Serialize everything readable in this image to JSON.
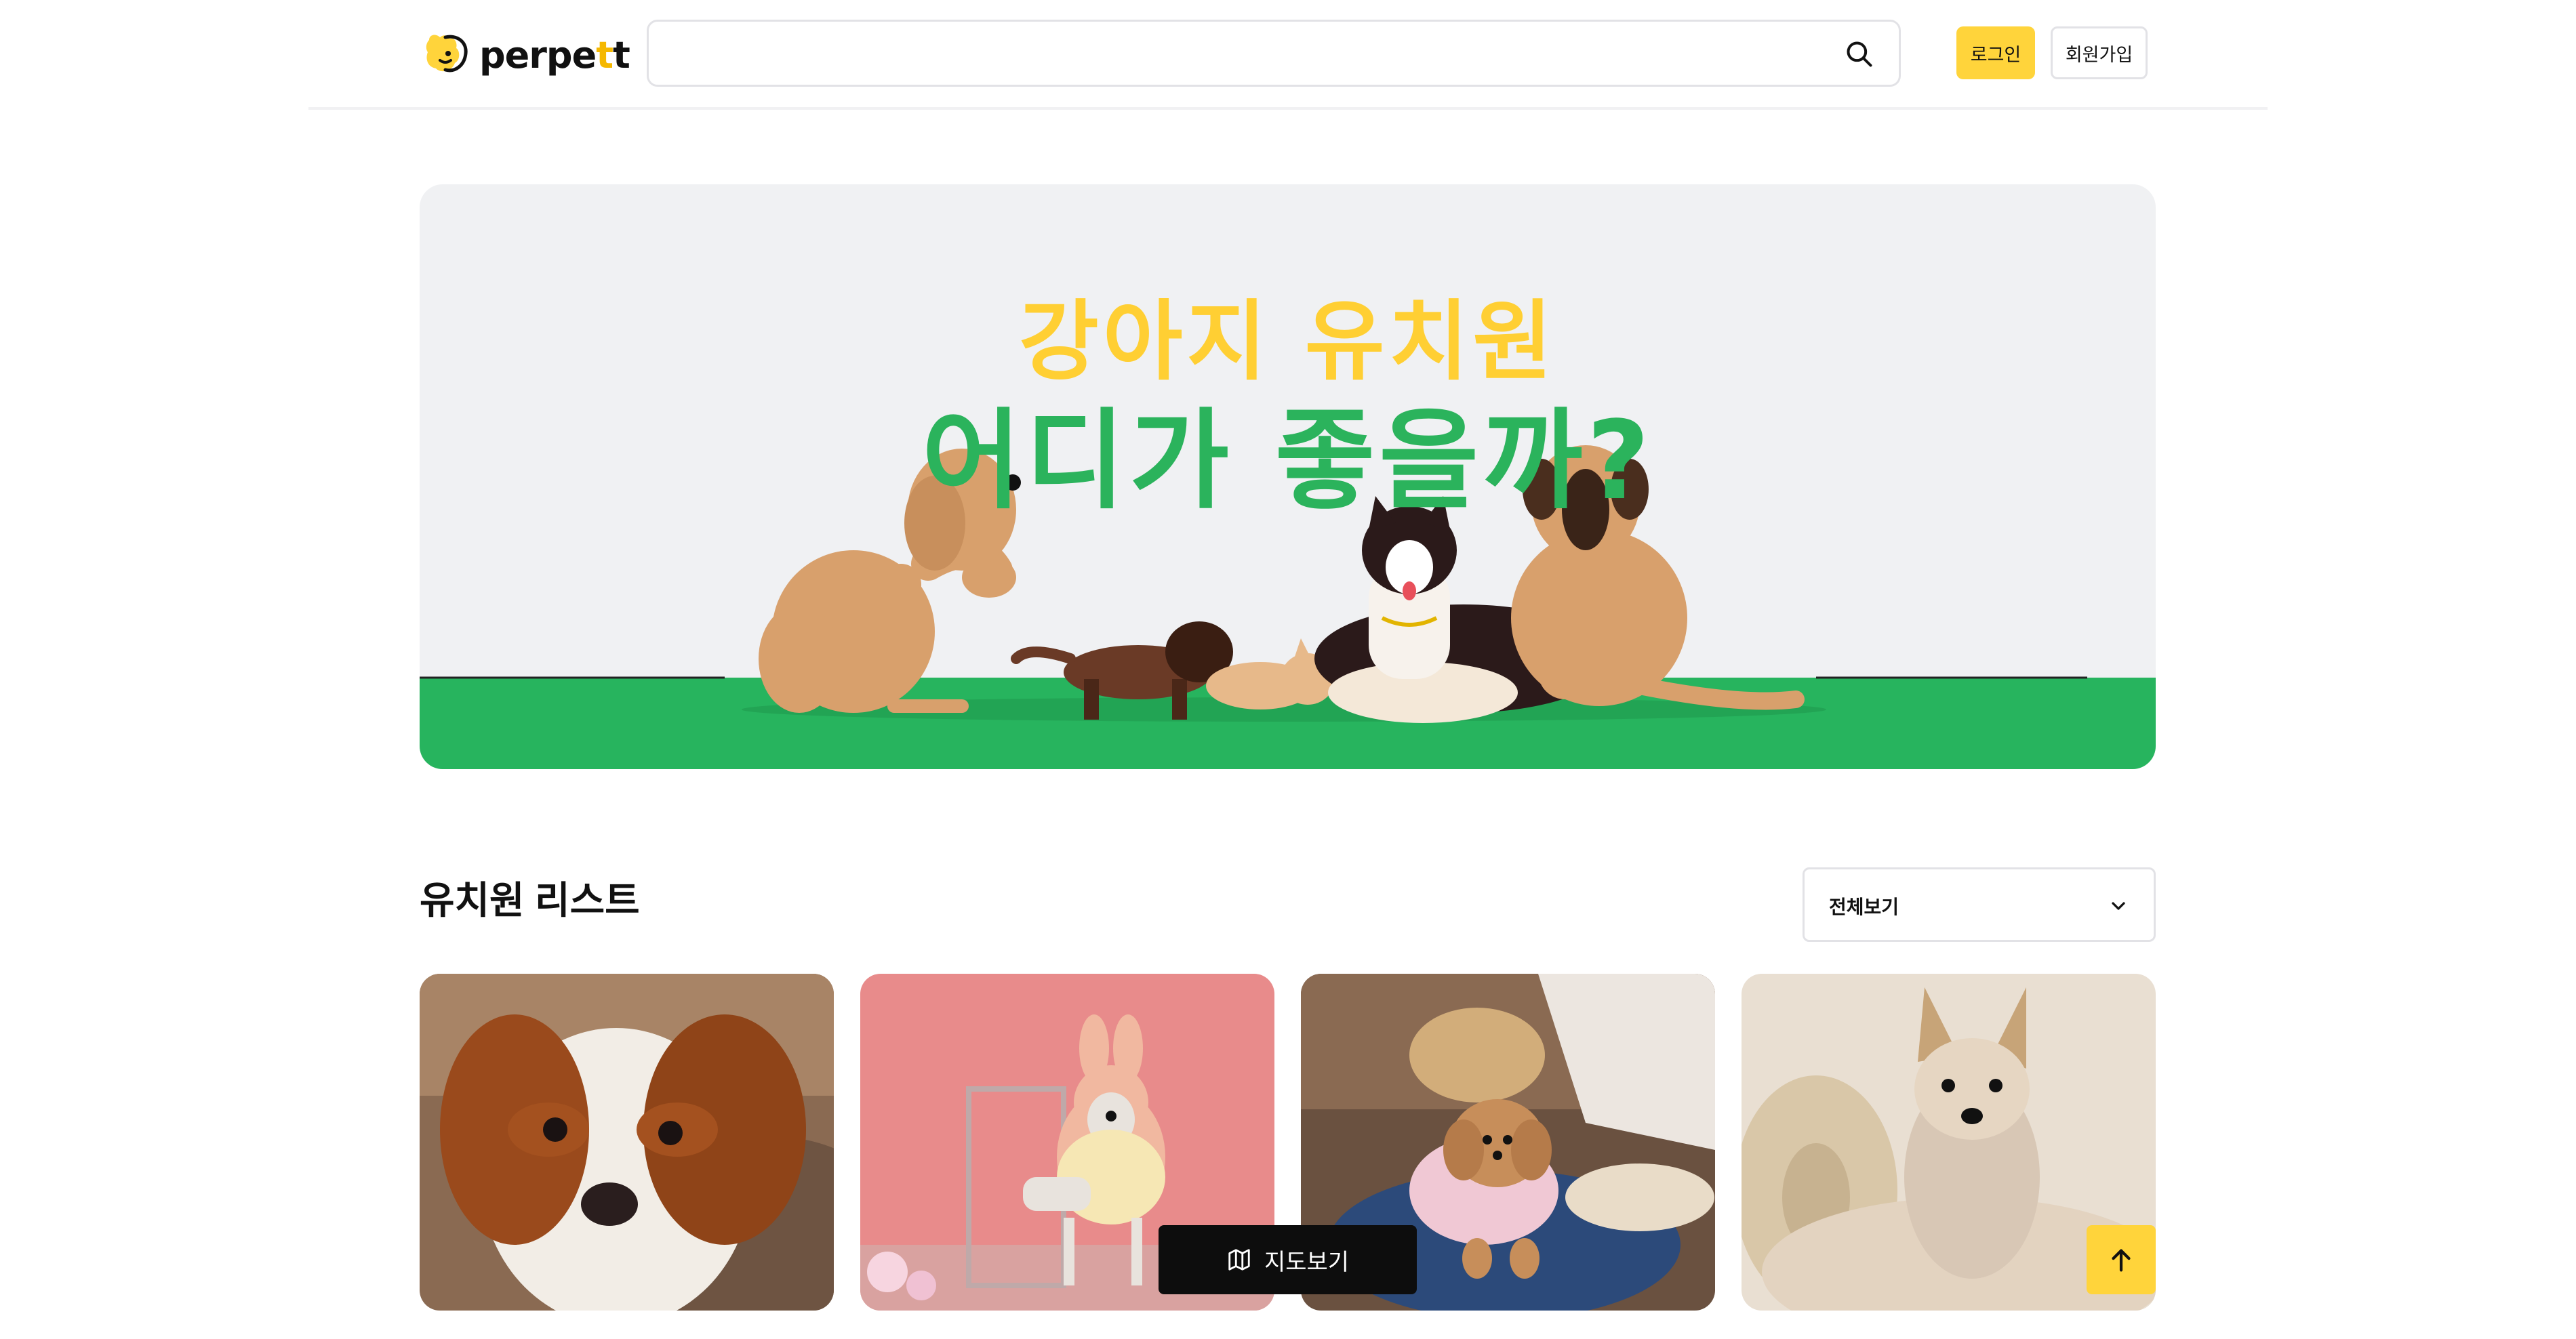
{
  "header": {
    "logo": {
      "text_main": "perpe",
      "text_accent": "t",
      "text_end": "t",
      "alt": "perpett"
    },
    "search": {
      "value": "",
      "placeholder": ""
    },
    "login_label": "로그인",
    "signup_label": "회원가입"
  },
  "banner": {
    "line1": "강아지 유치원",
    "line2": "어디가 좋을까?",
    "colors": {
      "line1": "#ffcf33",
      "line2": "#2bb35c",
      "grass": "#27b45e",
      "background": "#f0f1f3"
    }
  },
  "list": {
    "title": "유치원 리스트",
    "filter": {
      "selected": "전체보기"
    },
    "cards": [
      {
        "icon": "puppy-photo-cavalier"
      },
      {
        "icon": "puppy-photo-bunny-hat"
      },
      {
        "icon": "puppy-photo-poodle"
      },
      {
        "icon": "puppy-photo-yorkie"
      }
    ]
  },
  "floating": {
    "map_label": "지도보기",
    "map_icon": "map-icon",
    "top_icon": "arrow-up-icon"
  },
  "colors": {
    "accent": "#ffd43b",
    "border": "#e2e2e6",
    "dark": "#0d0d0d"
  }
}
